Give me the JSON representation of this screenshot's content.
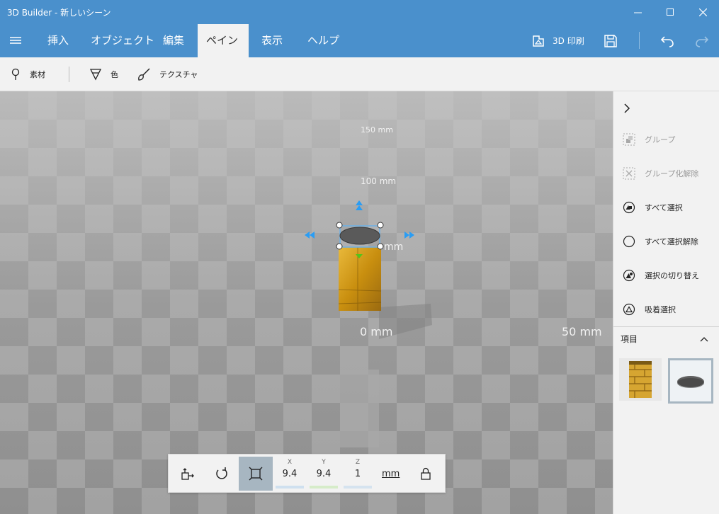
{
  "window": {
    "title": "3D Builder - 新しいシーン"
  },
  "menu": {
    "tabs": [
      "挿入",
      "オブジェクト",
      "編集",
      "ペイント",
      "表示",
      "ヘルプ"
    ],
    "active_tab": "ペイント",
    "print_label": "3D 印刷"
  },
  "ribbon": {
    "material_label": "素材",
    "color_label": "色",
    "texture_label": "テクスチャ"
  },
  "viewport": {
    "ruler_150": "150 mm",
    "ruler_100": "100 mm",
    "ruler_50_near": "mm",
    "ruler_0": "0 mm",
    "ruler_50_right": "50 mm"
  },
  "side_panel": {
    "group_label": "グループ",
    "ungroup_label": "グループ化解除",
    "select_all_label": "すべて選択",
    "deselect_all_label": "すべて選択解除",
    "invert_selection_label": "選択の切り替え",
    "magnet_select_label": "吸着選択",
    "items_header": "項目"
  },
  "transform": {
    "x_label": "X",
    "y_label": "Y",
    "z_label": "Z",
    "x_value": "9.4",
    "y_value": "9.4",
    "z_value": "1",
    "unit": "mm"
  },
  "colors": {
    "accent": "#4a90cc",
    "x_axis": "#cfe0ef",
    "y_axis": "#d6ecc9",
    "z_axis": "#d5e3ef"
  }
}
